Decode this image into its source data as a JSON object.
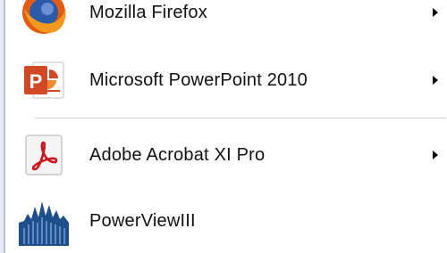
{
  "menu": {
    "items": [
      {
        "label": "Mozilla Firefox",
        "icon": "firefox-icon",
        "has_submenu": true
      },
      {
        "label": "Microsoft PowerPoint 2010",
        "icon": "powerpoint-icon",
        "has_submenu": true
      },
      {
        "label": "Adobe Acrobat XI Pro",
        "icon": "acrobat-icon",
        "has_submenu": true
      },
      {
        "label": "PowerViewIII",
        "icon": "powerview-icon",
        "has_submenu": false
      }
    ]
  },
  "colors": {
    "powerpoint_orange": "#d24726",
    "acrobat_red": "#c8161d",
    "powerview_blue": "#1f4e8c",
    "separator": "#c9d3e1"
  }
}
